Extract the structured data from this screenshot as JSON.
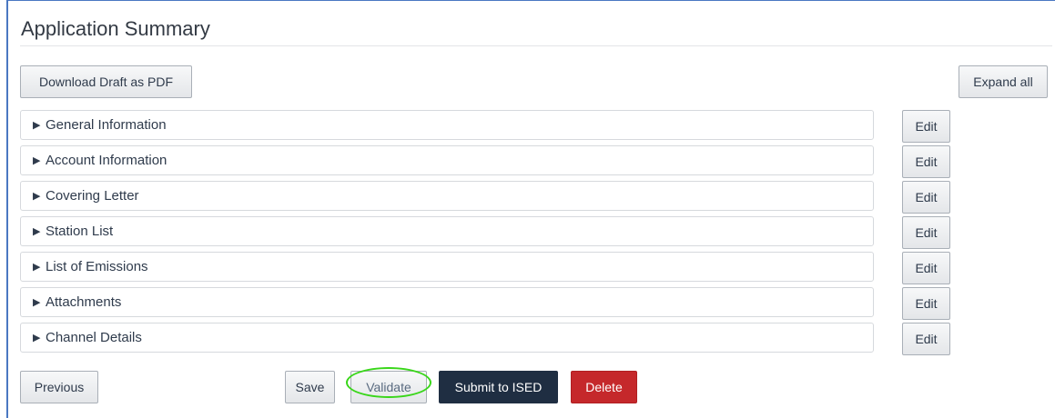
{
  "header": {
    "title": "Application Summary"
  },
  "toolbar": {
    "download_label": "Download Draft as PDF",
    "expand_label": "Expand all"
  },
  "sections": [
    {
      "label": "General Information",
      "edit_label": "Edit"
    },
    {
      "label": "Account Information",
      "edit_label": "Edit"
    },
    {
      "label": "Covering Letter",
      "edit_label": "Edit"
    },
    {
      "label": "Station List",
      "edit_label": "Edit"
    },
    {
      "label": "List of Emissions",
      "edit_label": "Edit"
    },
    {
      "label": "Attachments",
      "edit_label": "Edit"
    },
    {
      "label": "Channel Details",
      "edit_label": "Edit"
    }
  ],
  "footer": {
    "previous_label": "Previous",
    "save_label": "Save",
    "validate_label": "Validate",
    "submit_label": "Submit to ISED",
    "delete_label": "Delete"
  },
  "colors": {
    "submit_bg": "#1f2e42",
    "delete_bg": "#c5282b",
    "highlight_circle": "#39d61a"
  }
}
